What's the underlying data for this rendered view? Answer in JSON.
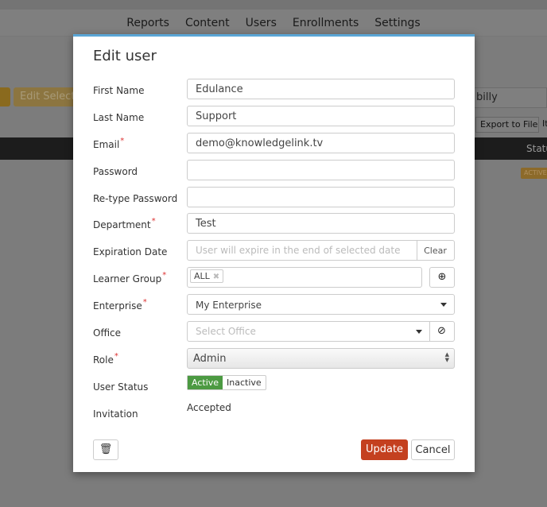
{
  "nav": {
    "items": [
      "Reports",
      "Content",
      "Users",
      "Enrollments",
      "Settings"
    ]
  },
  "background": {
    "edit_selected": "Edit Selected",
    "search_value": "billy",
    "export": "Export to File",
    "it": "It",
    "status_header": "Status",
    "badge": "ACTIVE"
  },
  "modal": {
    "title": "Edit user",
    "fields": {
      "first_name": {
        "label": "First Name",
        "value": "Edulance"
      },
      "last_name": {
        "label": "Last Name",
        "value": "Support"
      },
      "email": {
        "label": "Email",
        "value": "demo@knowledgelink.tv"
      },
      "password": {
        "label": "Password",
        "value": ""
      },
      "retype": {
        "label": "Re-type Password",
        "value": ""
      },
      "department": {
        "label": "Department",
        "value": "Test"
      },
      "expiration": {
        "label": "Expiration Date",
        "placeholder": "User will expire in the end of selected date",
        "clear": "Clear"
      },
      "learner_group": {
        "label": "Learner Group",
        "tag": "ALL",
        "remove": "✖"
      },
      "enterprise": {
        "label": "Enterprise",
        "value": "My Enterprise"
      },
      "office": {
        "label": "Office",
        "placeholder": "Select Office"
      },
      "role": {
        "label": "Role",
        "value": "Admin"
      },
      "status": {
        "label": "User Status",
        "active": "Active",
        "inactive": "Inactive",
        "selected": "Active"
      },
      "invitation": {
        "label": "Invitation",
        "value": "Accepted"
      }
    },
    "required_mark": "*",
    "update": "Update",
    "cancel": "Cancel"
  },
  "colors": {
    "accent": "#5aa6d6",
    "update": "#c4401f",
    "active": "#4c9a42"
  }
}
